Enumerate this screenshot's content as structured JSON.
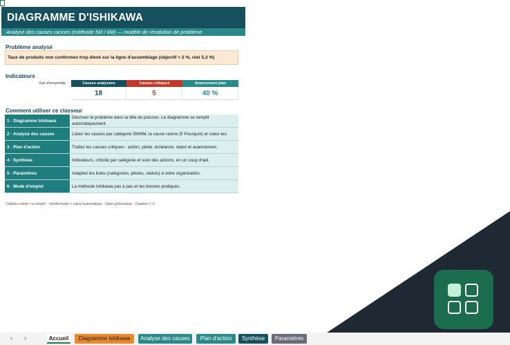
{
  "sheet": {
    "title": "DIAGRAMME D'ISHIKAWA",
    "subtitle": "Analyse des causes racines (méthode 5M / 6M) — modèle de résolution de problème"
  },
  "problem": {
    "heading": "Problème analysé",
    "text": "Taux de produits non conformes trop élevé sur la ligne d'assemblage (objectif < 2 %, réel 5,3 %)"
  },
  "indicators": {
    "heading": "Indicateurs",
    "row_label": "Vue d'ensemble",
    "items": [
      {
        "label": "Causes analysées",
        "value": "18",
        "header_color": "#15505e",
        "value_color": "#15505e"
      },
      {
        "label": "Causes critiques",
        "value": "5",
        "header_color": "#c0392b",
        "value_color": "#c0392b"
      },
      {
        "label": "Avancement plan",
        "value": "40 %",
        "header_color": "#2a8a8a",
        "value_color": "#2a8a8a"
      }
    ]
  },
  "guide": {
    "heading": "Comment utiliser ce classeur",
    "rows": [
      {
        "name": "1 · Diagramme Ishikawa",
        "desc": "Décrivez le problème dans la tête du poisson. Le diagramme se remplit automatiquement."
      },
      {
        "name": "2 · Analyse des causes",
        "desc": "Listez les causes par catégorie 5M/6M, la cause racine (5 Pourquoi) et cotez-les."
      },
      {
        "name": "3 · Plan d'action",
        "desc": "Traitez les causes critiques : action, pilote, échéance, statut et avancement."
      },
      {
        "name": "4 · Synthèse",
        "desc": "Indicateurs, criticité par catégorie et suivi des actions, en un coup d'œil."
      },
      {
        "name": "5 · Paramètres",
        "desc": "Adaptez les listes (catégories, pilotes, statuts) à votre organisation."
      },
      {
        "name": "6 · Mode d'emploi",
        "desc": "La méthode Ishikawa pas à pas et les bonnes pratiques."
      }
    ]
  },
  "legend": "Cellules crème = à remplir  ·  Vert/formules = calcul automatique  ·  Dates jj/mm/aaaa  ·  Cotation 1–5",
  "tabs": [
    {
      "label": "Accueil",
      "active": true,
      "color": "#ffffff"
    },
    {
      "label": "Diagramme Ishikawa",
      "active": false,
      "color": "#e8892b"
    },
    {
      "label": "Analyse des causes",
      "active": false,
      "color": "#2a8a8a"
    },
    {
      "label": "Plan d'action",
      "active": false,
      "color": "#2a8a8a"
    },
    {
      "label": "Synthèse",
      "active": false,
      "color": "#15505e"
    },
    {
      "label": "Paramètres",
      "active": false,
      "color": "#6b6b78"
    }
  ],
  "nav": {
    "prev": "‹",
    "next": "›"
  },
  "colors": {
    "dark_overlay": "#1f2933",
    "app_icon": "#1c6d4d"
  },
  "icon": {
    "name": "app-grid-icon"
  }
}
